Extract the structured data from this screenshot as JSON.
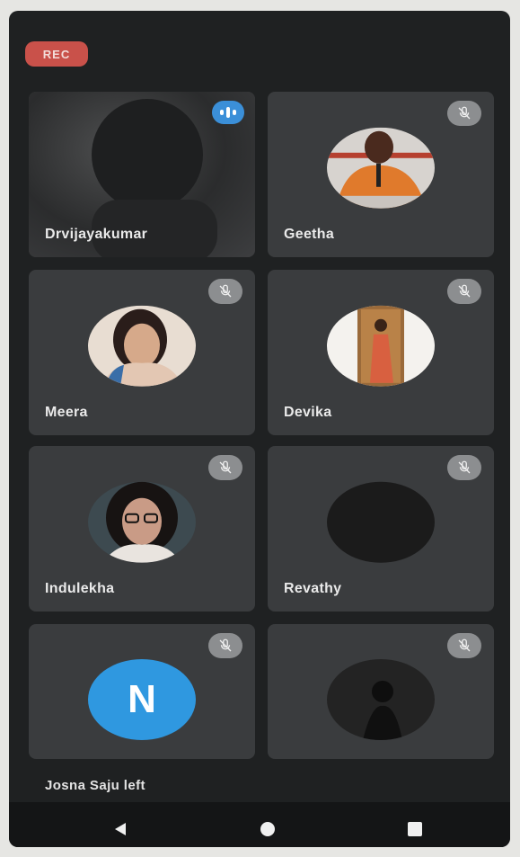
{
  "recording": {
    "label": "REC",
    "color": "#c9514a"
  },
  "participants": [
    {
      "name": "Drvijayakumar",
      "mic": "speaking",
      "avatar_type": "video"
    },
    {
      "name": "Geetha",
      "mic": "muted",
      "avatar_type": "photo"
    },
    {
      "name": "Meera",
      "mic": "muted",
      "avatar_type": "photo"
    },
    {
      "name": "Devika",
      "mic": "muted",
      "avatar_type": "photo"
    },
    {
      "name": "Indulekha",
      "mic": "muted",
      "avatar_type": "photo"
    },
    {
      "name": "Revathy",
      "mic": "muted",
      "avatar_type": "photo"
    },
    {
      "name": "",
      "mic": "muted",
      "avatar_type": "letter",
      "initial": "N"
    },
    {
      "name": "",
      "mic": "muted",
      "avatar_type": "photo"
    }
  ],
  "notification": {
    "text": "Josna Saju left"
  },
  "nav": {
    "back_icon": "triangle-back-icon",
    "home_icon": "circle-home-icon",
    "recents_icon": "square-recents-icon"
  },
  "colors": {
    "background": "#1f2122",
    "tile": "#3a3c3e",
    "speaking": "#3b8fd8",
    "muted_badge": "#8c8e90",
    "letter_avatar": "#2f98e0"
  }
}
